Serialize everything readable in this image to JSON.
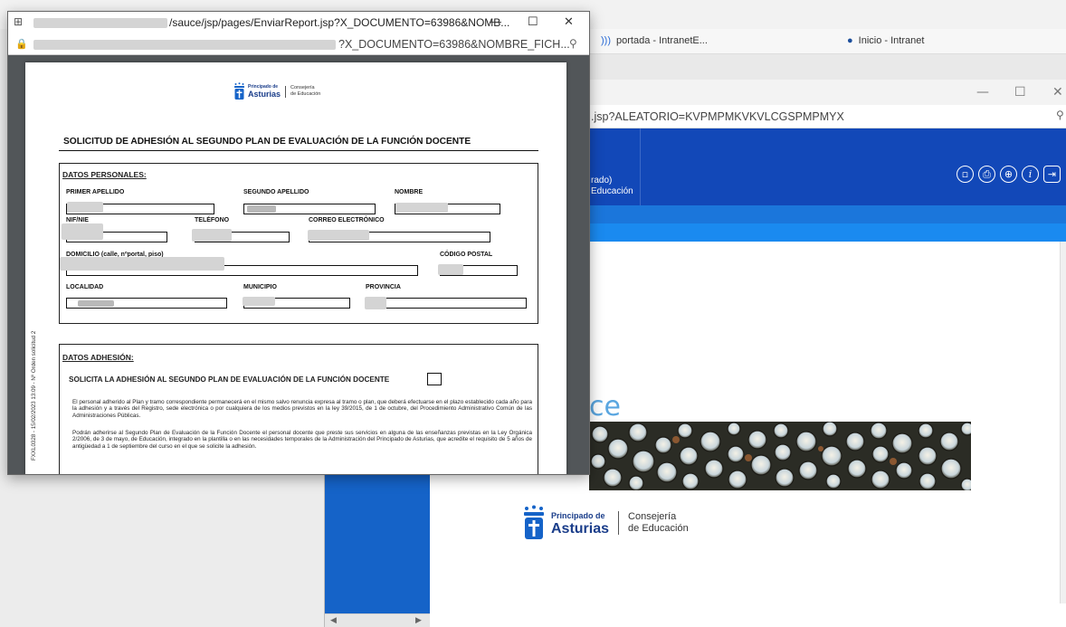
{
  "background_browser": {
    "bookmarks": [
      {
        "icon": "link-icon",
        "label": "portada - IntranetE..."
      },
      {
        "icon": "bookmark-icon",
        "label": "Inicio - Intranet"
      }
    ]
  },
  "back_window": {
    "url": ".jsp?ALEATORIO=KVPMPMKVKVLCGSPMPMYX",
    "header_line1": "rado)",
    "header_line2": "Educación",
    "brand_text": "ce",
    "header_icons": [
      "copy-icon",
      "print-icon",
      "target-icon",
      "info-icon",
      "exit-icon"
    ],
    "footer_logo": {
      "line1": "Principado de",
      "line2": "Asturias",
      "right1": "Consejería",
      "right2": "de Educación"
    }
  },
  "popup": {
    "title_url": "/sauce/jsp/pages/EnviarReport.jsp?X_DOCUMENTO=63986&NOMB...",
    "address_url": "?X_DOCUMENTO=63986&NOMBRE_FICH...",
    "controls": {
      "minimize": "—",
      "maximize": "☐",
      "close": "✕"
    }
  },
  "document": {
    "logo": {
      "line1": "Principado de",
      "line2": "Asturias",
      "right1": "Consejería",
      "right2": "de Educación"
    },
    "title": "SOLICITUD DE ADHESIÓN AL SEGUNDO PLAN DE EVALUACIÓN DE LA FUNCIÓN DOCENTE",
    "personal": {
      "heading": "DATOS PERSONALES:",
      "primer_apellido": "PRIMER APELLIDO",
      "segundo_apellido": "SEGUNDO APELLIDO",
      "nombre": "NOMBRE",
      "nif": "NIF/NIE",
      "telefono": "TELÉFONO",
      "correo": "CORREO ELECTRÓNICO",
      "domicilio": "DOMICILIO (calle, nºportal, piso)",
      "codigo_postal": "CÓDIGO POSTAL",
      "localidad": "LOCALIDAD",
      "municipio": "MUNICIPIO",
      "provincia": "PROVINCIA"
    },
    "adhesion": {
      "heading": "DATOS ADHESIÓN:",
      "solicita": "SOLICITA LA ADHESIÓN  AL SEGUNDO PLAN DE EVALUACIÓN DE LA FUNCIÓN DOCENTE",
      "para1": "El personal adherido al Plan y tramo correspondiente permanecerá en el mismo salvo renuncia expresa al tramo o plan, que deberá efectuarse en el plazo establecido cada año para la adhesión y a través del Registro, sede electrónica o por cualquiera de los medios previstos en la ley 39/2015, de 1 de octubre, del Procedimiento Administrativo Común de las Administraciones Públicas.",
      "para2": "Podrán adherirse al Segundo Plan de Evaluación de la Función Docente el personal docente que preste sus servicios en alguna de las enseñanzas previstas en la Ley Orgánica 2/2006, de 3 de mayo, de Educación, integrado en la plantilla o en las necesidades temporales de la Administración del Principado de Asturias, que acredite el requisito de 5 años de antigüedad a 1 de septiembre del curso en el que se solicite la adhesión."
    },
    "side_note": "FXXL0328 - 15/02/2023 13:09 - Nº Orden solicitud 2"
  }
}
